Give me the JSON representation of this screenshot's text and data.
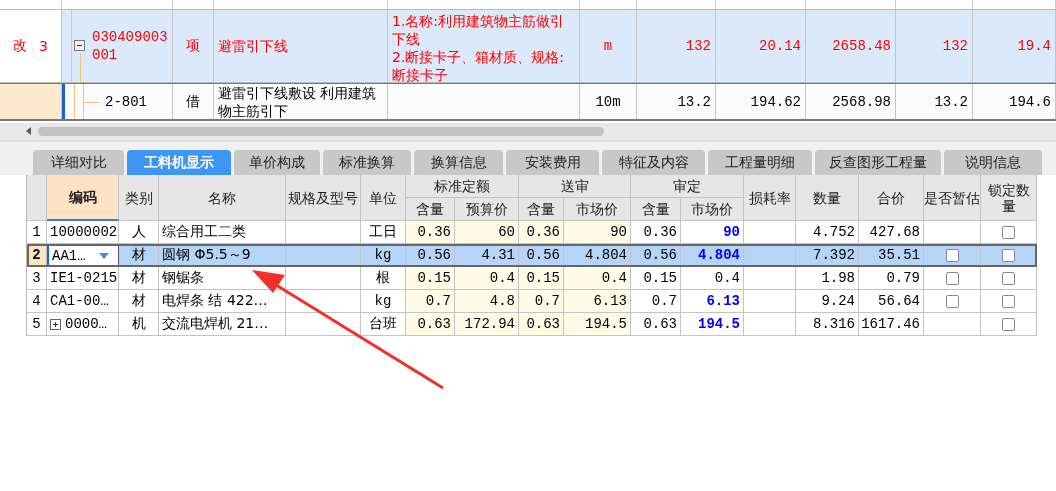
{
  "upper_table": {
    "rows": [
      {
        "kind": "item",
        "selected": false,
        "status": "改",
        "number": "3",
        "expanded": true,
        "code": "030409003001",
        "type": "项",
        "name": "避雷引下线",
        "features": [
          "1.名称:利用建筑物主筋做引下线",
          "2.断接卡子、箱材质、规格:断接卡子"
        ],
        "unit": "m",
        "values": [
          "132",
          "20.14",
          "2658.48",
          "132",
          "19.4"
        ]
      },
      {
        "kind": "sub",
        "selected": true,
        "code": "2-801",
        "type": "借",
        "name": "避雷引下线敷设 利用建筑物主筋引下",
        "unit": "10m",
        "values": [
          "13.2",
          "194.62",
          "2568.98",
          "13.2",
          "194.6"
        ]
      }
    ]
  },
  "tabs": [
    {
      "label": "详细对比",
      "selected": false
    },
    {
      "label": "工料机显示",
      "selected": true
    },
    {
      "label": "单价构成",
      "selected": false
    },
    {
      "label": "标准换算",
      "selected": false
    },
    {
      "label": "换算信息",
      "selected": false
    },
    {
      "label": "安装费用",
      "selected": false
    },
    {
      "label": "特征及内容",
      "selected": false
    },
    {
      "label": "工程量明细",
      "selected": false
    },
    {
      "label": "反查图形工程量",
      "selected": false
    },
    {
      "label": "说明信息",
      "selected": false
    }
  ],
  "grid": {
    "columns": [
      {
        "label": "编码",
        "selected": true
      },
      {
        "label": "类别",
        "selected": false
      },
      {
        "label": "名称",
        "selected": false
      },
      {
        "label": "规格及型号",
        "selected": false
      },
      {
        "label": "单位",
        "selected": false
      },
      {
        "label": "标准定额",
        "selected": false,
        "shaded": true,
        "children": [
          "含量",
          "预算价"
        ]
      },
      {
        "label": "送审",
        "selected": false,
        "shaded": true,
        "children": [
          "含量",
          "市场价"
        ]
      },
      {
        "label": "审定",
        "selected": false,
        "shaded": false,
        "children": [
          "含量",
          "市场价"
        ]
      },
      {
        "label": "损耗率",
        "selected": false
      },
      {
        "label": "数量",
        "selected": false
      },
      {
        "label": "合价",
        "selected": false
      },
      {
        "label": "是否暂估",
        "selected": false
      },
      {
        "label": "锁定数量",
        "selected": false
      }
    ],
    "rows": [
      {
        "number": "1",
        "selected": false,
        "code": "10000002",
        "type": "人",
        "name": "综合用工二类",
        "unit": "工日",
        "values": [
          "0.36",
          "60",
          "0.36",
          "90",
          "0.36",
          "90"
        ],
        "price_changed": true,
        "quantity": "4.752",
        "total": "427.68",
        "lock": {
          "checked": false
        }
      },
      {
        "number": "2",
        "selected": true,
        "code": "AA1…",
        "type": "材",
        "name": "圆钢 Φ5.5～9",
        "unit": "kg",
        "values": [
          "0.56",
          "4.31",
          "0.56",
          "4.804",
          "0.56",
          "4.804"
        ],
        "price_changed": true,
        "quantity": "7.392",
        "total": "35.51",
        "provisional": {
          "checked": false
        },
        "lock": {
          "checked": false
        }
      },
      {
        "number": "3",
        "selected": false,
        "code": "IE1-0215",
        "type": "材",
        "name": "钢锯条",
        "unit": "根",
        "values": [
          "0.15",
          "0.4",
          "0.15",
          "0.4",
          "0.15",
          "0.4"
        ],
        "price_changed": false,
        "quantity": "1.98",
        "total": "0.79",
        "provisional": {
          "checked": false
        },
        "lock": {
          "checked": false
        }
      },
      {
        "number": "4",
        "selected": false,
        "code": "CA1-00…",
        "type": "材",
        "name": "电焊条 结 422…",
        "unit": "kg",
        "values": [
          "0.7",
          "4.8",
          "0.7",
          "6.13",
          "0.7",
          "6.13"
        ],
        "price_changed": true,
        "quantity": "9.24",
        "total": "56.64",
        "provisional": {
          "checked": false
        },
        "lock": {
          "checked": false
        }
      },
      {
        "number": "5",
        "selected": false,
        "expanded": false,
        "code": "0000…",
        "type": "机",
        "name": "交流电焊机 21…",
        "unit": "台班",
        "values": [
          "0.63",
          "172.94",
          "0.63",
          "194.5",
          "0.63",
          "194.5"
        ],
        "price_changed": true,
        "quantity": "8.316",
        "total": "1617.46",
        "lock": {
          "checked": false
        }
      }
    ]
  }
}
